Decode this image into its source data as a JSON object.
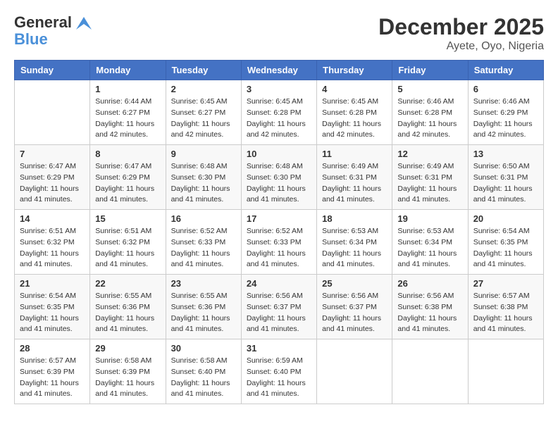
{
  "header": {
    "logo_general": "General",
    "logo_blue": "Blue",
    "month": "December 2025",
    "location": "Ayete, Oyo, Nigeria"
  },
  "weekdays": [
    "Sunday",
    "Monday",
    "Tuesday",
    "Wednesday",
    "Thursday",
    "Friday",
    "Saturday"
  ],
  "weeks": [
    [
      {
        "day": "",
        "sunrise": "",
        "sunset": "",
        "daylight": ""
      },
      {
        "day": "1",
        "sunrise": "Sunrise: 6:44 AM",
        "sunset": "Sunset: 6:27 PM",
        "daylight": "Daylight: 11 hours and 42 minutes."
      },
      {
        "day": "2",
        "sunrise": "Sunrise: 6:45 AM",
        "sunset": "Sunset: 6:27 PM",
        "daylight": "Daylight: 11 hours and 42 minutes."
      },
      {
        "day": "3",
        "sunrise": "Sunrise: 6:45 AM",
        "sunset": "Sunset: 6:28 PM",
        "daylight": "Daylight: 11 hours and 42 minutes."
      },
      {
        "day": "4",
        "sunrise": "Sunrise: 6:45 AM",
        "sunset": "Sunset: 6:28 PM",
        "daylight": "Daylight: 11 hours and 42 minutes."
      },
      {
        "day": "5",
        "sunrise": "Sunrise: 6:46 AM",
        "sunset": "Sunset: 6:28 PM",
        "daylight": "Daylight: 11 hours and 42 minutes."
      },
      {
        "day": "6",
        "sunrise": "Sunrise: 6:46 AM",
        "sunset": "Sunset: 6:29 PM",
        "daylight": "Daylight: 11 hours and 42 minutes."
      }
    ],
    [
      {
        "day": "7",
        "sunrise": "Sunrise: 6:47 AM",
        "sunset": "Sunset: 6:29 PM",
        "daylight": "Daylight: 11 hours and 41 minutes."
      },
      {
        "day": "8",
        "sunrise": "Sunrise: 6:47 AM",
        "sunset": "Sunset: 6:29 PM",
        "daylight": "Daylight: 11 hours and 41 minutes."
      },
      {
        "day": "9",
        "sunrise": "Sunrise: 6:48 AM",
        "sunset": "Sunset: 6:30 PM",
        "daylight": "Daylight: 11 hours and 41 minutes."
      },
      {
        "day": "10",
        "sunrise": "Sunrise: 6:48 AM",
        "sunset": "Sunset: 6:30 PM",
        "daylight": "Daylight: 11 hours and 41 minutes."
      },
      {
        "day": "11",
        "sunrise": "Sunrise: 6:49 AM",
        "sunset": "Sunset: 6:31 PM",
        "daylight": "Daylight: 11 hours and 41 minutes."
      },
      {
        "day": "12",
        "sunrise": "Sunrise: 6:49 AM",
        "sunset": "Sunset: 6:31 PM",
        "daylight": "Daylight: 11 hours and 41 minutes."
      },
      {
        "day": "13",
        "sunrise": "Sunrise: 6:50 AM",
        "sunset": "Sunset: 6:31 PM",
        "daylight": "Daylight: 11 hours and 41 minutes."
      }
    ],
    [
      {
        "day": "14",
        "sunrise": "Sunrise: 6:51 AM",
        "sunset": "Sunset: 6:32 PM",
        "daylight": "Daylight: 11 hours and 41 minutes."
      },
      {
        "day": "15",
        "sunrise": "Sunrise: 6:51 AM",
        "sunset": "Sunset: 6:32 PM",
        "daylight": "Daylight: 11 hours and 41 minutes."
      },
      {
        "day": "16",
        "sunrise": "Sunrise: 6:52 AM",
        "sunset": "Sunset: 6:33 PM",
        "daylight": "Daylight: 11 hours and 41 minutes."
      },
      {
        "day": "17",
        "sunrise": "Sunrise: 6:52 AM",
        "sunset": "Sunset: 6:33 PM",
        "daylight": "Daylight: 11 hours and 41 minutes."
      },
      {
        "day": "18",
        "sunrise": "Sunrise: 6:53 AM",
        "sunset": "Sunset: 6:34 PM",
        "daylight": "Daylight: 11 hours and 41 minutes."
      },
      {
        "day": "19",
        "sunrise": "Sunrise: 6:53 AM",
        "sunset": "Sunset: 6:34 PM",
        "daylight": "Daylight: 11 hours and 41 minutes."
      },
      {
        "day": "20",
        "sunrise": "Sunrise: 6:54 AM",
        "sunset": "Sunset: 6:35 PM",
        "daylight": "Daylight: 11 hours and 41 minutes."
      }
    ],
    [
      {
        "day": "21",
        "sunrise": "Sunrise: 6:54 AM",
        "sunset": "Sunset: 6:35 PM",
        "daylight": "Daylight: 11 hours and 41 minutes."
      },
      {
        "day": "22",
        "sunrise": "Sunrise: 6:55 AM",
        "sunset": "Sunset: 6:36 PM",
        "daylight": "Daylight: 11 hours and 41 minutes."
      },
      {
        "day": "23",
        "sunrise": "Sunrise: 6:55 AM",
        "sunset": "Sunset: 6:36 PM",
        "daylight": "Daylight: 11 hours and 41 minutes."
      },
      {
        "day": "24",
        "sunrise": "Sunrise: 6:56 AM",
        "sunset": "Sunset: 6:37 PM",
        "daylight": "Daylight: 11 hours and 41 minutes."
      },
      {
        "day": "25",
        "sunrise": "Sunrise: 6:56 AM",
        "sunset": "Sunset: 6:37 PM",
        "daylight": "Daylight: 11 hours and 41 minutes."
      },
      {
        "day": "26",
        "sunrise": "Sunrise: 6:56 AM",
        "sunset": "Sunset: 6:38 PM",
        "daylight": "Daylight: 11 hours and 41 minutes."
      },
      {
        "day": "27",
        "sunrise": "Sunrise: 6:57 AM",
        "sunset": "Sunset: 6:38 PM",
        "daylight": "Daylight: 11 hours and 41 minutes."
      }
    ],
    [
      {
        "day": "28",
        "sunrise": "Sunrise: 6:57 AM",
        "sunset": "Sunset: 6:39 PM",
        "daylight": "Daylight: 11 hours and 41 minutes."
      },
      {
        "day": "29",
        "sunrise": "Sunrise: 6:58 AM",
        "sunset": "Sunset: 6:39 PM",
        "daylight": "Daylight: 11 hours and 41 minutes."
      },
      {
        "day": "30",
        "sunrise": "Sunrise: 6:58 AM",
        "sunset": "Sunset: 6:40 PM",
        "daylight": "Daylight: 11 hours and 41 minutes."
      },
      {
        "day": "31",
        "sunrise": "Sunrise: 6:59 AM",
        "sunset": "Sunset: 6:40 PM",
        "daylight": "Daylight: 11 hours and 41 minutes."
      },
      {
        "day": "",
        "sunrise": "",
        "sunset": "",
        "daylight": ""
      },
      {
        "day": "",
        "sunrise": "",
        "sunset": "",
        "daylight": ""
      },
      {
        "day": "",
        "sunrise": "",
        "sunset": "",
        "daylight": ""
      }
    ]
  ]
}
